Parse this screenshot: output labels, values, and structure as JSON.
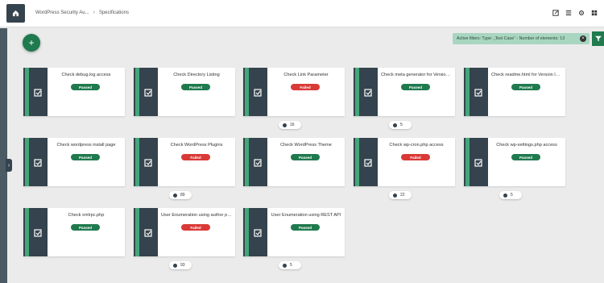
{
  "breadcrumb": {
    "project": "WordPress Security Au...",
    "page": "Specifications"
  },
  "filter": {
    "text": "Active filters: Type: „Test Case“ - Number of elements: 13"
  },
  "cards": [
    {
      "title": "Check debug.log access",
      "status": "Passed"
    },
    {
      "title": "Check Directory Listing",
      "status": "Passed"
    },
    {
      "title": "Check Link Parameter",
      "status": "Failed",
      "count": "16"
    },
    {
      "title": "Check meta generator for Version le...",
      "status": "Passed",
      "count": "5"
    },
    {
      "title": "Check readme.html for Version leak...",
      "status": "Passed"
    },
    {
      "title": "Check wordpress install page",
      "status": "Passed"
    },
    {
      "title": "Check WordPress Plugins",
      "status": "Failed",
      "count": "89"
    },
    {
      "title": "Check WordPress Theme",
      "status": "Passed"
    },
    {
      "title": "Check wp-cron.php access",
      "status": "Failed",
      "count": "22"
    },
    {
      "title": "Check wp-settings.php access",
      "status": "Passed",
      "count": "5"
    },
    {
      "title": "Check xmlrpc.php",
      "status": "Passed"
    },
    {
      "title": "User Enumeration using author page",
      "status": "Failed",
      "count": "93"
    },
    {
      "title": "User Enumeration using REST API",
      "status": "Passed",
      "count": "5"
    }
  ],
  "icons": {
    "home": "home-icon",
    "add": "plus-icon",
    "filter": "filter-icon",
    "card": "test-case-icon"
  }
}
